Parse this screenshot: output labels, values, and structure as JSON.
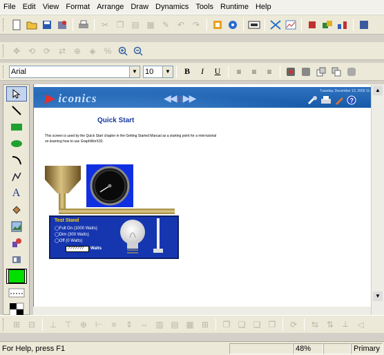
{
  "menu": [
    "File",
    "Edit",
    "View",
    "Format",
    "Arrange",
    "Draw",
    "Dynamics",
    "Tools",
    "Runtime",
    "Help"
  ],
  "font": {
    "name": "Arial",
    "size": "10"
  },
  "format_buttons": [
    "B",
    "I",
    "U"
  ],
  "graphic": {
    "title": "Quick Start",
    "date": "Tuesday, December 13, 2005 11:48:42",
    "description": "This screen is used by the Quick Start chapter in the Getting Started Manual as a starting point for a mini-tutorial on learning how to use GraphWorX32.",
    "test_stand": {
      "title": "Test Stand",
      "options": [
        "Full On (1000 Watts)",
        "Dim (300 Watts)",
        "Off (0 Watts)"
      ],
      "value": "???????",
      "unit": "Watts"
    }
  },
  "status": {
    "help": "For Help, press F1",
    "zoom": "48%",
    "layer": "Primary"
  },
  "colors": {
    "accent": "#1636b0",
    "fill_swatch": "#00e000"
  }
}
